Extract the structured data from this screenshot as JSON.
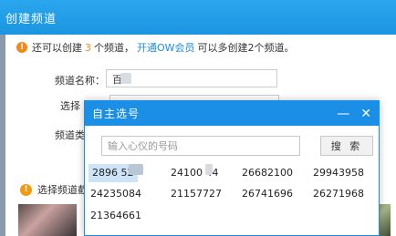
{
  "background_window": {
    "title": "创建频道",
    "notice": {
      "prefix": "还可以创建",
      "count": "3",
      "suffix": "个频道，",
      "link": "开通OW会员",
      "tail": "可以多创建2个频道。"
    },
    "form": {
      "name_label": "频道名称：",
      "name_value": "百",
      "choose_label": "选择",
      "type_label": "频道类"
    },
    "warning_text": "选择频道截"
  },
  "dialog": {
    "title": "自主选号",
    "minimize": "—",
    "close": "✕",
    "search_placeholder": "输入心仪的号码",
    "search_button": "搜 索",
    "numbers": [
      "2896   52",
      "24100 44",
      "26682100",
      "29943958",
      "24235084",
      "21157727",
      "26741696",
      "26271968",
      "21364661"
    ]
  }
}
